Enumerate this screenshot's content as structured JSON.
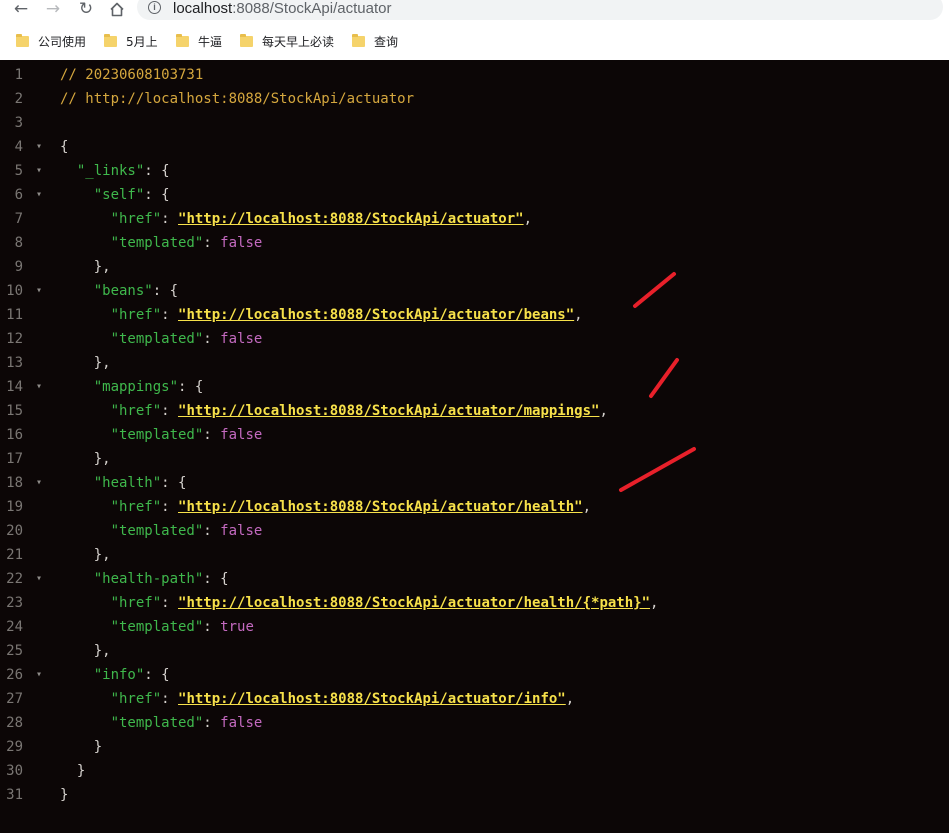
{
  "browser": {
    "url_host": "localhost",
    "url_path": ":8088/StockApi/actuator",
    "bookmarks": [
      "公司使用",
      "5月上",
      "牛逼",
      "每天早上必读",
      "查询"
    ]
  },
  "code": {
    "lines": [
      [
        [
          "comment",
          "// 20230608103731"
        ]
      ],
      [
        [
          "comment",
          "// http://localhost:8088/StockApi/actuator"
        ]
      ],
      [],
      [
        [
          "punc",
          "{"
        ]
      ],
      [
        [
          "punc",
          "  "
        ],
        [
          "key",
          "\"_links\""
        ],
        [
          "punc",
          ": {"
        ]
      ],
      [
        [
          "punc",
          "    "
        ],
        [
          "key",
          "\"self\""
        ],
        [
          "punc",
          ": {"
        ]
      ],
      [
        [
          "punc",
          "      "
        ],
        [
          "key",
          "\"href\""
        ],
        [
          "punc",
          ": "
        ],
        [
          "link",
          "\"http://localhost:8088/StockApi/actuator\""
        ],
        [
          "punc",
          ","
        ]
      ],
      [
        [
          "punc",
          "      "
        ],
        [
          "key",
          "\"templated\""
        ],
        [
          "punc",
          ": "
        ],
        [
          "bool",
          "false"
        ]
      ],
      [
        [
          "punc",
          "    },"
        ]
      ],
      [
        [
          "punc",
          "    "
        ],
        [
          "key",
          "\"beans\""
        ],
        [
          "punc",
          ": {"
        ]
      ],
      [
        [
          "punc",
          "      "
        ],
        [
          "key",
          "\"href\""
        ],
        [
          "punc",
          ": "
        ],
        [
          "link",
          "\"http://localhost:8088/StockApi/actuator/beans\""
        ],
        [
          "punc",
          ","
        ]
      ],
      [
        [
          "punc",
          "      "
        ],
        [
          "key",
          "\"templated\""
        ],
        [
          "punc",
          ": "
        ],
        [
          "bool",
          "false"
        ]
      ],
      [
        [
          "punc",
          "    },"
        ]
      ],
      [
        [
          "punc",
          "    "
        ],
        [
          "key",
          "\"mappings\""
        ],
        [
          "punc",
          ": {"
        ]
      ],
      [
        [
          "punc",
          "      "
        ],
        [
          "key",
          "\"href\""
        ],
        [
          "punc",
          ": "
        ],
        [
          "link",
          "\"http://localhost:8088/StockApi/actuator/mappings\""
        ],
        [
          "punc",
          ","
        ]
      ],
      [
        [
          "punc",
          "      "
        ],
        [
          "key",
          "\"templated\""
        ],
        [
          "punc",
          ": "
        ],
        [
          "bool",
          "false"
        ]
      ],
      [
        [
          "punc",
          "    },"
        ]
      ],
      [
        [
          "punc",
          "    "
        ],
        [
          "key",
          "\"health\""
        ],
        [
          "punc",
          ": {"
        ]
      ],
      [
        [
          "punc",
          "      "
        ],
        [
          "key",
          "\"href\""
        ],
        [
          "punc",
          ": "
        ],
        [
          "link",
          "\"http://localhost:8088/StockApi/actuator/health\""
        ],
        [
          "punc",
          ","
        ]
      ],
      [
        [
          "punc",
          "      "
        ],
        [
          "key",
          "\"templated\""
        ],
        [
          "punc",
          ": "
        ],
        [
          "bool",
          "false"
        ]
      ],
      [
        [
          "punc",
          "    },"
        ]
      ],
      [
        [
          "punc",
          "    "
        ],
        [
          "key",
          "\"health-path\""
        ],
        [
          "punc",
          ": {"
        ]
      ],
      [
        [
          "punc",
          "      "
        ],
        [
          "key",
          "\"href\""
        ],
        [
          "punc",
          ": "
        ],
        [
          "link",
          "\"http://localhost:8088/StockApi/actuator/health/{*path}\""
        ],
        [
          "punc",
          ","
        ]
      ],
      [
        [
          "punc",
          "      "
        ],
        [
          "key",
          "\"templated\""
        ],
        [
          "punc",
          ": "
        ],
        [
          "bool",
          "true"
        ]
      ],
      [
        [
          "punc",
          "    },"
        ]
      ],
      [
        [
          "punc",
          "    "
        ],
        [
          "key",
          "\"info\""
        ],
        [
          "punc",
          ": {"
        ]
      ],
      [
        [
          "punc",
          "      "
        ],
        [
          "key",
          "\"href\""
        ],
        [
          "punc",
          ": "
        ],
        [
          "link",
          "\"http://localhost:8088/StockApi/actuator/info\""
        ],
        [
          "punc",
          ","
        ]
      ],
      [
        [
          "punc",
          "      "
        ],
        [
          "key",
          "\"templated\""
        ],
        [
          "punc",
          ": "
        ],
        [
          "bool",
          "false"
        ]
      ],
      [
        [
          "punc",
          "    }"
        ]
      ],
      [
        [
          "punc",
          "  }"
        ]
      ],
      [
        [
          "punc",
          "}"
        ]
      ]
    ],
    "fold_lines": [
      4,
      5,
      6,
      10,
      14,
      18,
      22,
      26
    ]
  },
  "colors": {
    "background": "#0c0606",
    "comment": "#d5a73e",
    "key": "#3fb84c",
    "link": "#f7e14a",
    "bool": "#c46ac0",
    "annotation": "#e8202a"
  },
  "icons": {
    "back": "arrow-left-icon",
    "forward": "arrow-right-icon",
    "reload": "reload-icon",
    "home": "home-icon",
    "site_info": "info-icon",
    "bookmark": "folder-icon",
    "fold": "caret-down-icon"
  }
}
